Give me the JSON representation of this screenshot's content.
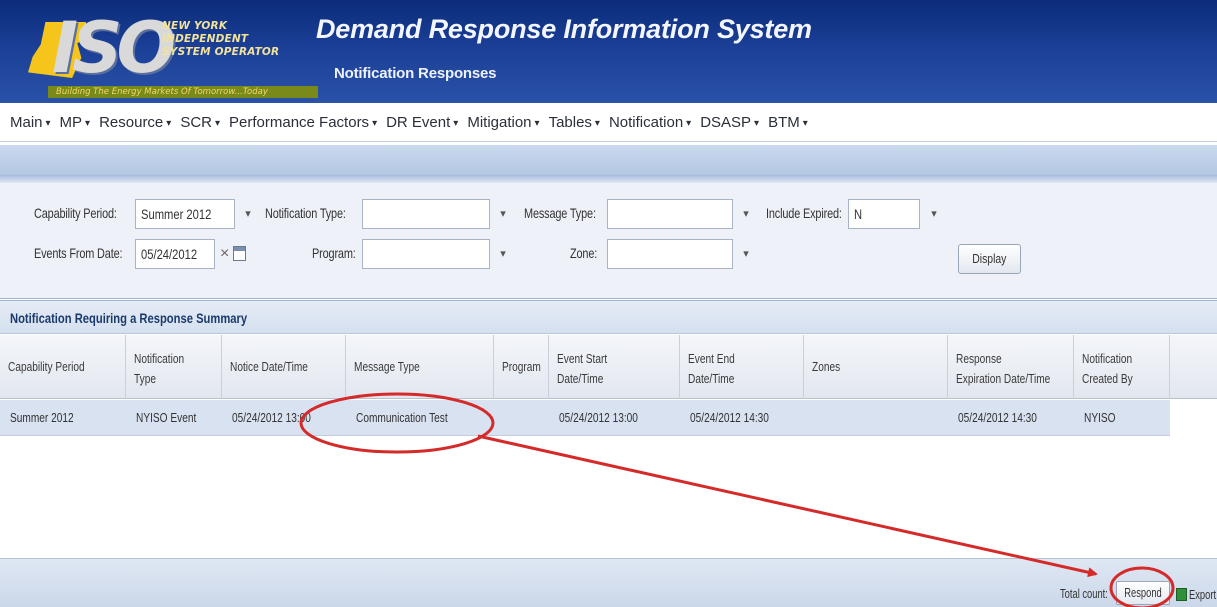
{
  "header": {
    "logo_text": "ISO",
    "logo_small_lines": [
      "NEW YORK",
      "INDEPENDENT",
      "SYSTEM OPERATOR"
    ],
    "logo_tagline": "Building The Energy Markets Of Tomorrow...Today",
    "app_title": "Demand Response Information System",
    "page_subtitle": "Notification Responses"
  },
  "menu": {
    "items": [
      {
        "label": "Main"
      },
      {
        "label": "MP"
      },
      {
        "label": "Resource"
      },
      {
        "label": "SCR"
      },
      {
        "label": "Performance Factors"
      },
      {
        "label": "DR Event"
      },
      {
        "label": "Mitigation"
      },
      {
        "label": "Tables"
      },
      {
        "label": "Notification"
      },
      {
        "label": "DSASP"
      },
      {
        "label": "BTM"
      }
    ],
    "caret": "▾"
  },
  "filters": {
    "capability_period_label": "Capability Period:",
    "capability_period_value": "Summer 2012",
    "notification_type_label": "Notification Type:",
    "notification_type_value": "",
    "message_type_label": "Message Type:",
    "message_type_value": "",
    "include_expired_label": "Include Expired:",
    "include_expired_value": "N",
    "events_from_date_label": "Events From Date:",
    "events_from_date_value": "05/24/2012",
    "program_label": "Program:",
    "program_value": "",
    "zone_label": "Zone:",
    "zone_value": "",
    "display_button": "Display",
    "clear_glyph": "×",
    "dropdown_glyph": "▾"
  },
  "summary": {
    "title": "Notification Requiring a Response Summary",
    "columns": [
      [
        "Capability Period"
      ],
      [
        "Notification",
        "Type"
      ],
      [
        "Notice Date/Time"
      ],
      [
        "Message Type"
      ],
      [
        "Program"
      ],
      [
        "Event Start",
        "Date/Time"
      ],
      [
        "Event End",
        "Date/Time"
      ],
      [
        "Zones"
      ],
      [
        "Response",
        "Expiration Date/Time"
      ],
      [
        "Notification",
        "Created By"
      ]
    ],
    "rows": [
      [
        "Summer 2012",
        "NYISO Event",
        "05/24/2012 13:00",
        "Communication Test",
        "",
        "05/24/2012 13:00",
        "05/24/2012 14:30",
        "",
        "05/24/2012 14:30",
        "NYISO"
      ]
    ]
  },
  "footer": {
    "total_count_label": "Total count:",
    "respond_button": "Respond",
    "export_button": "Export"
  },
  "annotation": {
    "color": "#d42a2a"
  }
}
